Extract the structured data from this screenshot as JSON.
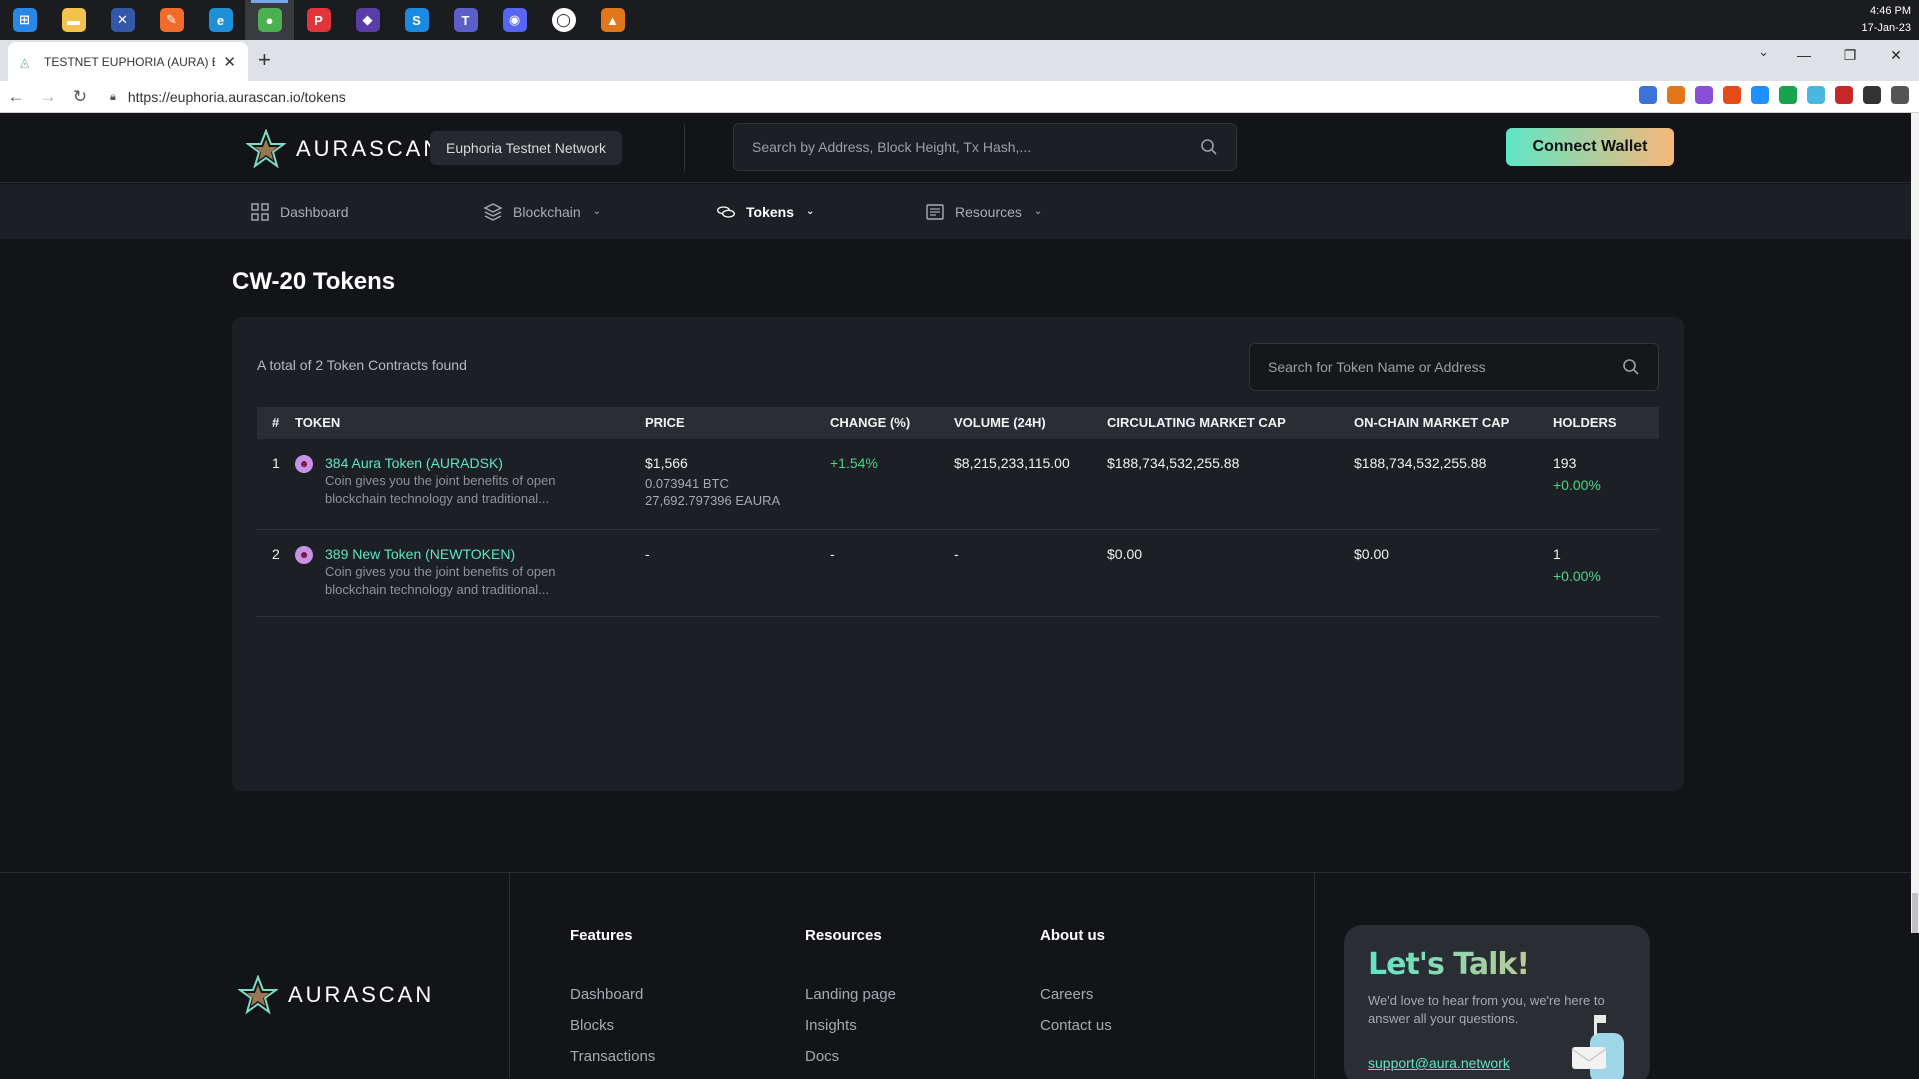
{
  "taskbar": {
    "apps": [
      {
        "name": "windows-start-icon",
        "color": "#2b87e6",
        "glyph": "⊞"
      },
      {
        "name": "file-explorer-icon",
        "color": "#f2c14e",
        "glyph": "▬"
      },
      {
        "name": "ide-icon",
        "color": "#3358a8",
        "glyph": "✕"
      },
      {
        "name": "postman-icon",
        "color": "#f26b2a",
        "glyph": "✎"
      },
      {
        "name": "edge-icon",
        "color": "#1f8fd6",
        "glyph": "e"
      },
      {
        "name": "chrome-icon",
        "color": "#4caf50",
        "glyph": "●"
      },
      {
        "name": "pdf-icon",
        "color": "#e0353b",
        "glyph": "P"
      },
      {
        "name": "git-icon",
        "color": "#5a3ea8",
        "glyph": "◆"
      },
      {
        "name": "skype-icon",
        "color": "#1a8be0",
        "glyph": "S"
      },
      {
        "name": "teams-icon",
        "color": "#5b5fc7",
        "glyph": "T"
      },
      {
        "name": "discord-icon",
        "color": "#5865f2",
        "glyph": "◉"
      },
      {
        "name": "github-desktop-icon",
        "color": "#ffffff",
        "glyph": "◯"
      },
      {
        "name": "metamask-icon",
        "color": "#e2761b",
        "glyph": "▲"
      }
    ],
    "clock_time": "4:46 PM",
    "clock_date": "17-Jan-23"
  },
  "browser": {
    "tab_title": "TESTNET EUPHORIA (AURA) Bloc",
    "url": "https://euphoria.aurascan.io/tokens",
    "extensions": [
      "#3b73d9",
      "#e2761b",
      "#8a4fd8",
      "#e64a19",
      "#1e90ff",
      "#16a34a",
      "#4ab7e0",
      "#c62828",
      "#333333",
      "#555555"
    ]
  },
  "header": {
    "logo_text": "AURASCAN",
    "network": "Euphoria Testnet Network",
    "search_placeholder": "Search by Address, Block Height, Tx Hash,...",
    "connect_label": "Connect Wallet"
  },
  "nav": {
    "dashboard": "Dashboard",
    "blockchain": "Blockchain",
    "tokens": "Tokens",
    "resources": "Resources"
  },
  "main": {
    "title": "CW-20 Tokens",
    "total_text": "A total of 2 Token Contracts found",
    "token_search_placeholder": "Search for Token Name or Address",
    "columns": {
      "num": "#",
      "token": "TOKEN",
      "price": "PRICE",
      "change": "CHANGE (%)",
      "volume": "VOLUME (24H)",
      "circ_cap": "CIRCULATING MARKET CAP",
      "onchain_cap": "ON-CHAIN MARKET CAP",
      "holders": "HOLDERS"
    },
    "rows": [
      {
        "num": "1",
        "name": "384 Aura Token (AURADSK)",
        "desc": "Coin gives you the joint benefits of open blockchain technology and traditional...",
        "price": "$1,566",
        "price_btc": "0.073941 BTC",
        "price_eaura": "27,692.797396 EAURA",
        "change": "+1.54%",
        "volume": "$8,215,233,115.00",
        "circ_cap": "$188,734,532,255.88",
        "onchain_cap": "$188,734,532,255.88",
        "holders": "193",
        "holders_change": "+0.00%"
      },
      {
        "num": "2",
        "name": "389 New Token (NEWTOKEN)",
        "desc": "Coin gives you the joint benefits of open blockchain technology and traditional...",
        "price": "-",
        "price_btc": "",
        "price_eaura": "",
        "change": "-",
        "volume": "-",
        "circ_cap": "$0.00",
        "onchain_cap": "$0.00",
        "holders": "1",
        "holders_change": "+0.00%"
      }
    ]
  },
  "footer": {
    "logo_text": "AURASCAN",
    "features": {
      "title": "Features",
      "links": [
        "Dashboard",
        "Blocks",
        "Transactions"
      ]
    },
    "resources": {
      "title": "Resources",
      "links": [
        "Landing page",
        "Insights",
        "Docs"
      ]
    },
    "about": {
      "title": "About us",
      "links": [
        "Careers",
        "Contact us"
      ]
    },
    "talk": {
      "title": "Let's Talk!",
      "text": "We'd love to hear from you, we're here to answer all your questions.",
      "email": "support@aura.network"
    }
  },
  "colors": {
    "accent": "#5ee6c6",
    "accent_gradient_end": "#f7b77a",
    "positive": "#4fd58a",
    "background": "#121417",
    "card": "#1c1f24"
  }
}
